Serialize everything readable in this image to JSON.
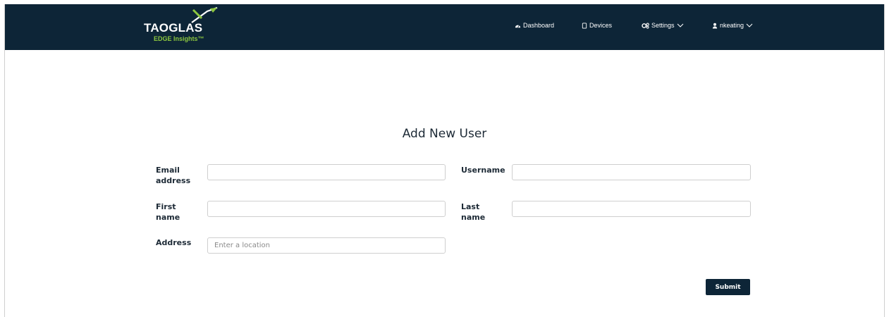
{
  "brand": {
    "name": "TAOGLAS",
    "tagline": "EDGE Insights™",
    "accent_color": "#8cc63f",
    "nav_color": "#0d2537"
  },
  "nav": {
    "dashboard": {
      "label": "Dashboard",
      "icon": "dashboard-icon"
    },
    "devices": {
      "label": "Devices",
      "icon": "device-icon"
    },
    "settings": {
      "label": "Settings",
      "icon": "gears-icon"
    },
    "user": {
      "label": "nkeating",
      "icon": "user-icon"
    }
  },
  "form": {
    "title": "Add New User",
    "email_label_1": "Email",
    "email_label_2": "address",
    "username_label": "Username",
    "first_name_label_1": "First",
    "first_name_label_2": "name",
    "last_name_label_1": "Last",
    "last_name_label_2": "name",
    "address_label": "Address",
    "address_placeholder": "Enter a location",
    "submit_label": "Submit"
  }
}
